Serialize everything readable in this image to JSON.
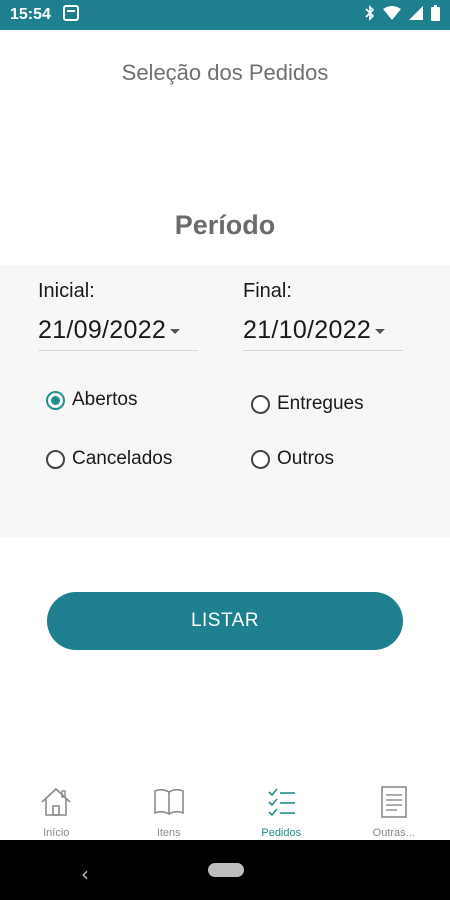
{
  "status_bar": {
    "time": "15:54",
    "icons": [
      "notification-icon",
      "bluetooth-icon",
      "wifi-icon",
      "signal-icon",
      "battery-icon"
    ]
  },
  "page": {
    "title": "Seleção dos Pedidos"
  },
  "period": {
    "title": "Período",
    "start_label": "Inicial:",
    "start_date": "21/09/2022",
    "end_label": "Final:",
    "end_date": "21/10/2022"
  },
  "filters": [
    {
      "label": "Abertos",
      "selected": true
    },
    {
      "label": "Entregues",
      "selected": false
    },
    {
      "label": "Cancelados",
      "selected": false
    },
    {
      "label": "Outros",
      "selected": false
    }
  ],
  "actions": {
    "list_label": "LISTAR"
  },
  "bottom_nav": [
    {
      "label": "Início",
      "icon": "home-icon",
      "active": false
    },
    {
      "label": "Itens",
      "icon": "book-icon",
      "active": false
    },
    {
      "label": "Pedidos",
      "icon": "checklist-icon",
      "active": true
    },
    {
      "label": "Outras...",
      "icon": "document-icon",
      "active": false
    }
  ],
  "colors": {
    "primary": "#1e7f8f",
    "accent": "#1e8f8a",
    "inactive": "#8a8a8a"
  }
}
